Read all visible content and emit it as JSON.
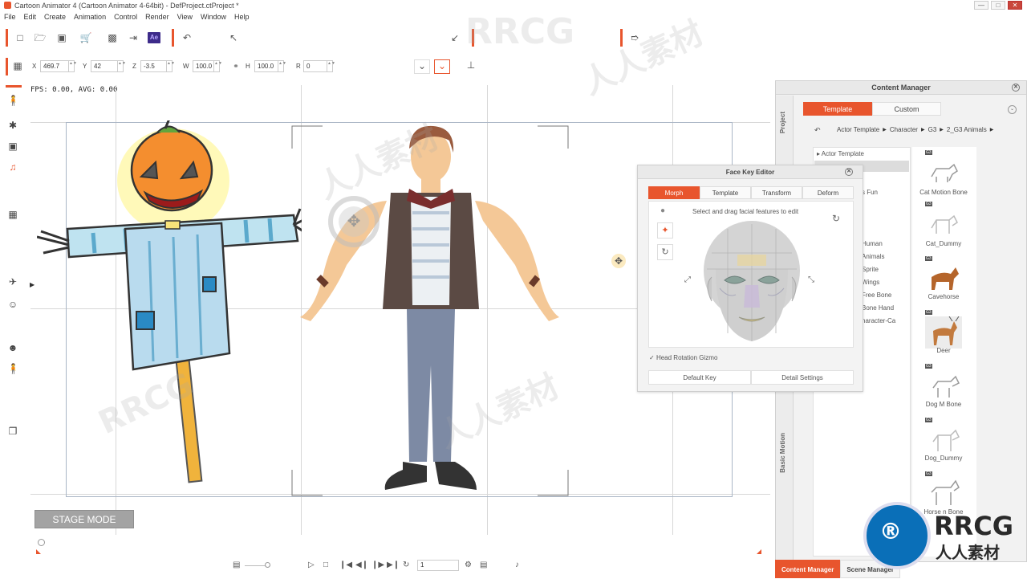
{
  "window": {
    "title": "Cartoon Animator 4  (Cartoon Animator 4-64bit) - DefProject.ctProject *",
    "controls": [
      "—",
      "□",
      "✕"
    ]
  },
  "menu": [
    "File",
    "Edit",
    "Create",
    "Animation",
    "Control",
    "Render",
    "View",
    "Window",
    "Help"
  ],
  "toolbar": {
    "ae_label": "Ae"
  },
  "transform": {
    "x_label": "X",
    "x_value": "469.7",
    "y_label": "Y",
    "y_value": "42",
    "z_label": "Z",
    "z_value": "-3.5",
    "w_label": "W",
    "w_value": "100.0",
    "h_label": "H",
    "h_value": "100.0",
    "r_label": "R",
    "r_value": "0"
  },
  "stage": {
    "fps_text": "FPS: 0.00, AVG: 0.00",
    "stage_mode_label": "STAGE MODE"
  },
  "playback": {
    "frame_value": "1"
  },
  "content_manager": {
    "title": "Content Manager",
    "side_tabs": [
      "Project",
      "Basic Motion"
    ],
    "tabs": [
      "Template",
      "Custom"
    ],
    "active_tab": "Template",
    "breadcrumb": [
      "Actor Template",
      "Character",
      "G3",
      "2_G3 Animals"
    ],
    "tree": [
      "Actor Template",
      "s Fun",
      "Human",
      "Animals",
      "Sprite",
      "Wings",
      "Free Bone",
      "Bone Hand",
      "haracter-Ca"
    ],
    "thumbnails": [
      {
        "label": "Cat Motion Bone",
        "badge": "G3"
      },
      {
        "label": "Cat_Dummy",
        "badge": "G3"
      },
      {
        "label": "Cavehorse",
        "badge": "G3"
      },
      {
        "label": "Deer",
        "badge": "G3"
      },
      {
        "label": "Dog M    Bone",
        "badge": "G3"
      },
      {
        "label": "Dog_Dummy",
        "badge": "G3"
      },
      {
        "label": "Horse    n Bone",
        "badge": "G3"
      }
    ],
    "selected_thumbnail": "Deer"
  },
  "bottom_tabs": [
    "Content Manager",
    "Scene Manager"
  ],
  "face_key_editor": {
    "title": "Face Key Editor",
    "tabs": [
      "Morph",
      "Template",
      "Transform",
      "Deform"
    ],
    "active_tab": "Morph",
    "hint": "Select and drag facial features to edit",
    "head_rotation_label": "Head Rotation Gizmo",
    "default_key_label": "Default Key",
    "detail_settings_label": "Detail Settings"
  },
  "watermark": {
    "text_a": "RRCG",
    "text_b": "人人素材"
  },
  "colors": {
    "accent": "#e8552d",
    "stage_border": "#aab6c6"
  }
}
